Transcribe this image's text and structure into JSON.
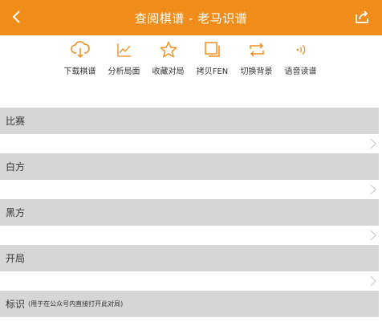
{
  "header": {
    "title": "查阅棋谱 - 老马识谱",
    "back_icon": "chevron-left-icon",
    "share_icon": "share-icon"
  },
  "colors": {
    "accent": "#f08c1a",
    "section_bg": "#d6d6d6",
    "text": "#333333"
  },
  "toolbar": {
    "items": [
      {
        "label": "下载棋谱",
        "icon": "cloud-download-icon"
      },
      {
        "label": "分析局面",
        "icon": "line-chart-icon"
      },
      {
        "label": "收藏对局",
        "icon": "star-icon"
      },
      {
        "label": "拷贝FEN",
        "icon": "copy-icon"
      },
      {
        "label": "切换背景",
        "icon": "swap-icon"
      },
      {
        "label": "语音读谱",
        "icon": "sound-icon"
      }
    ]
  },
  "sections": [
    {
      "label": "比赛",
      "value": ""
    },
    {
      "label": "白方",
      "value": ""
    },
    {
      "label": "黑方",
      "value": ""
    },
    {
      "label": "开局",
      "value": ""
    },
    {
      "label": "标识",
      "hint": "(用于在公众号内直接打开此对局)"
    }
  ]
}
